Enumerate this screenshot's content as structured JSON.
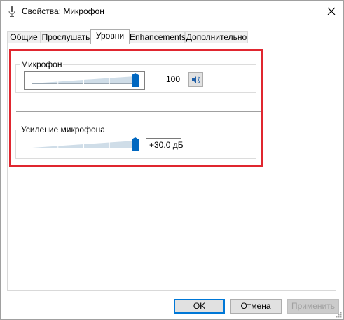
{
  "window": {
    "title": "Свойства: Микрофон",
    "icons": {
      "app": "microphone-icon",
      "close": "close-icon"
    }
  },
  "tabs": [
    {
      "label": "Общие",
      "active": false
    },
    {
      "label": "Прослушать",
      "active": false
    },
    {
      "label": "Уровни",
      "active": true
    },
    {
      "label": "Enhancements",
      "active": false
    },
    {
      "label": "Дополнительно",
      "active": false
    }
  ],
  "levels": {
    "microphone": {
      "label": "Микрофон",
      "value": "100",
      "level_fraction": 1.0,
      "mute_icon": "speaker-icon"
    },
    "boost": {
      "label": "Усиление микрофона",
      "value": "+30.0 дБ",
      "level_fraction": 1.0
    }
  },
  "buttons": {
    "ok": "OK",
    "cancel": "Отмена",
    "apply": "Применить"
  },
  "colors": {
    "accent": "#0078d7",
    "highlight": "#e0262f",
    "thumb": "#0067c0"
  }
}
